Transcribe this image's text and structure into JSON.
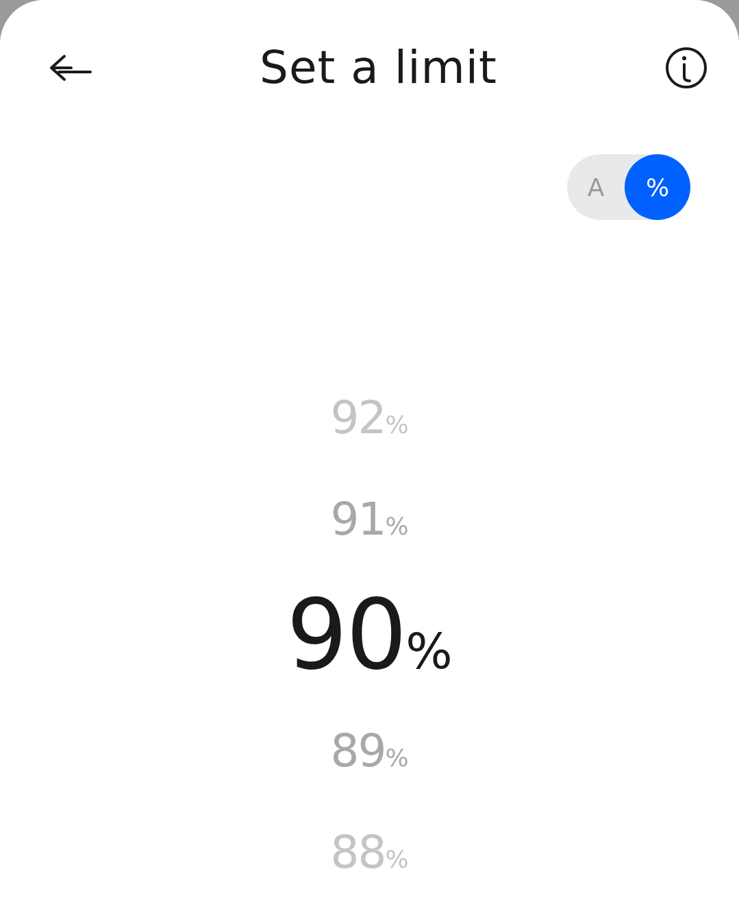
{
  "header": {
    "title": "Set a limit"
  },
  "unit_toggle": [
    {
      "label": "A",
      "selected": false
    },
    {
      "label": "%",
      "selected": true
    }
  ],
  "picker": [
    {
      "value": "92",
      "unit": "%",
      "selected": false
    },
    {
      "value": "91",
      "unit": "%",
      "selected": false
    },
    {
      "value": "90",
      "unit": "%",
      "selected": true
    },
    {
      "value": "89",
      "unit": "%",
      "selected": false
    },
    {
      "value": "88",
      "unit": "%",
      "selected": false
    }
  ]
}
